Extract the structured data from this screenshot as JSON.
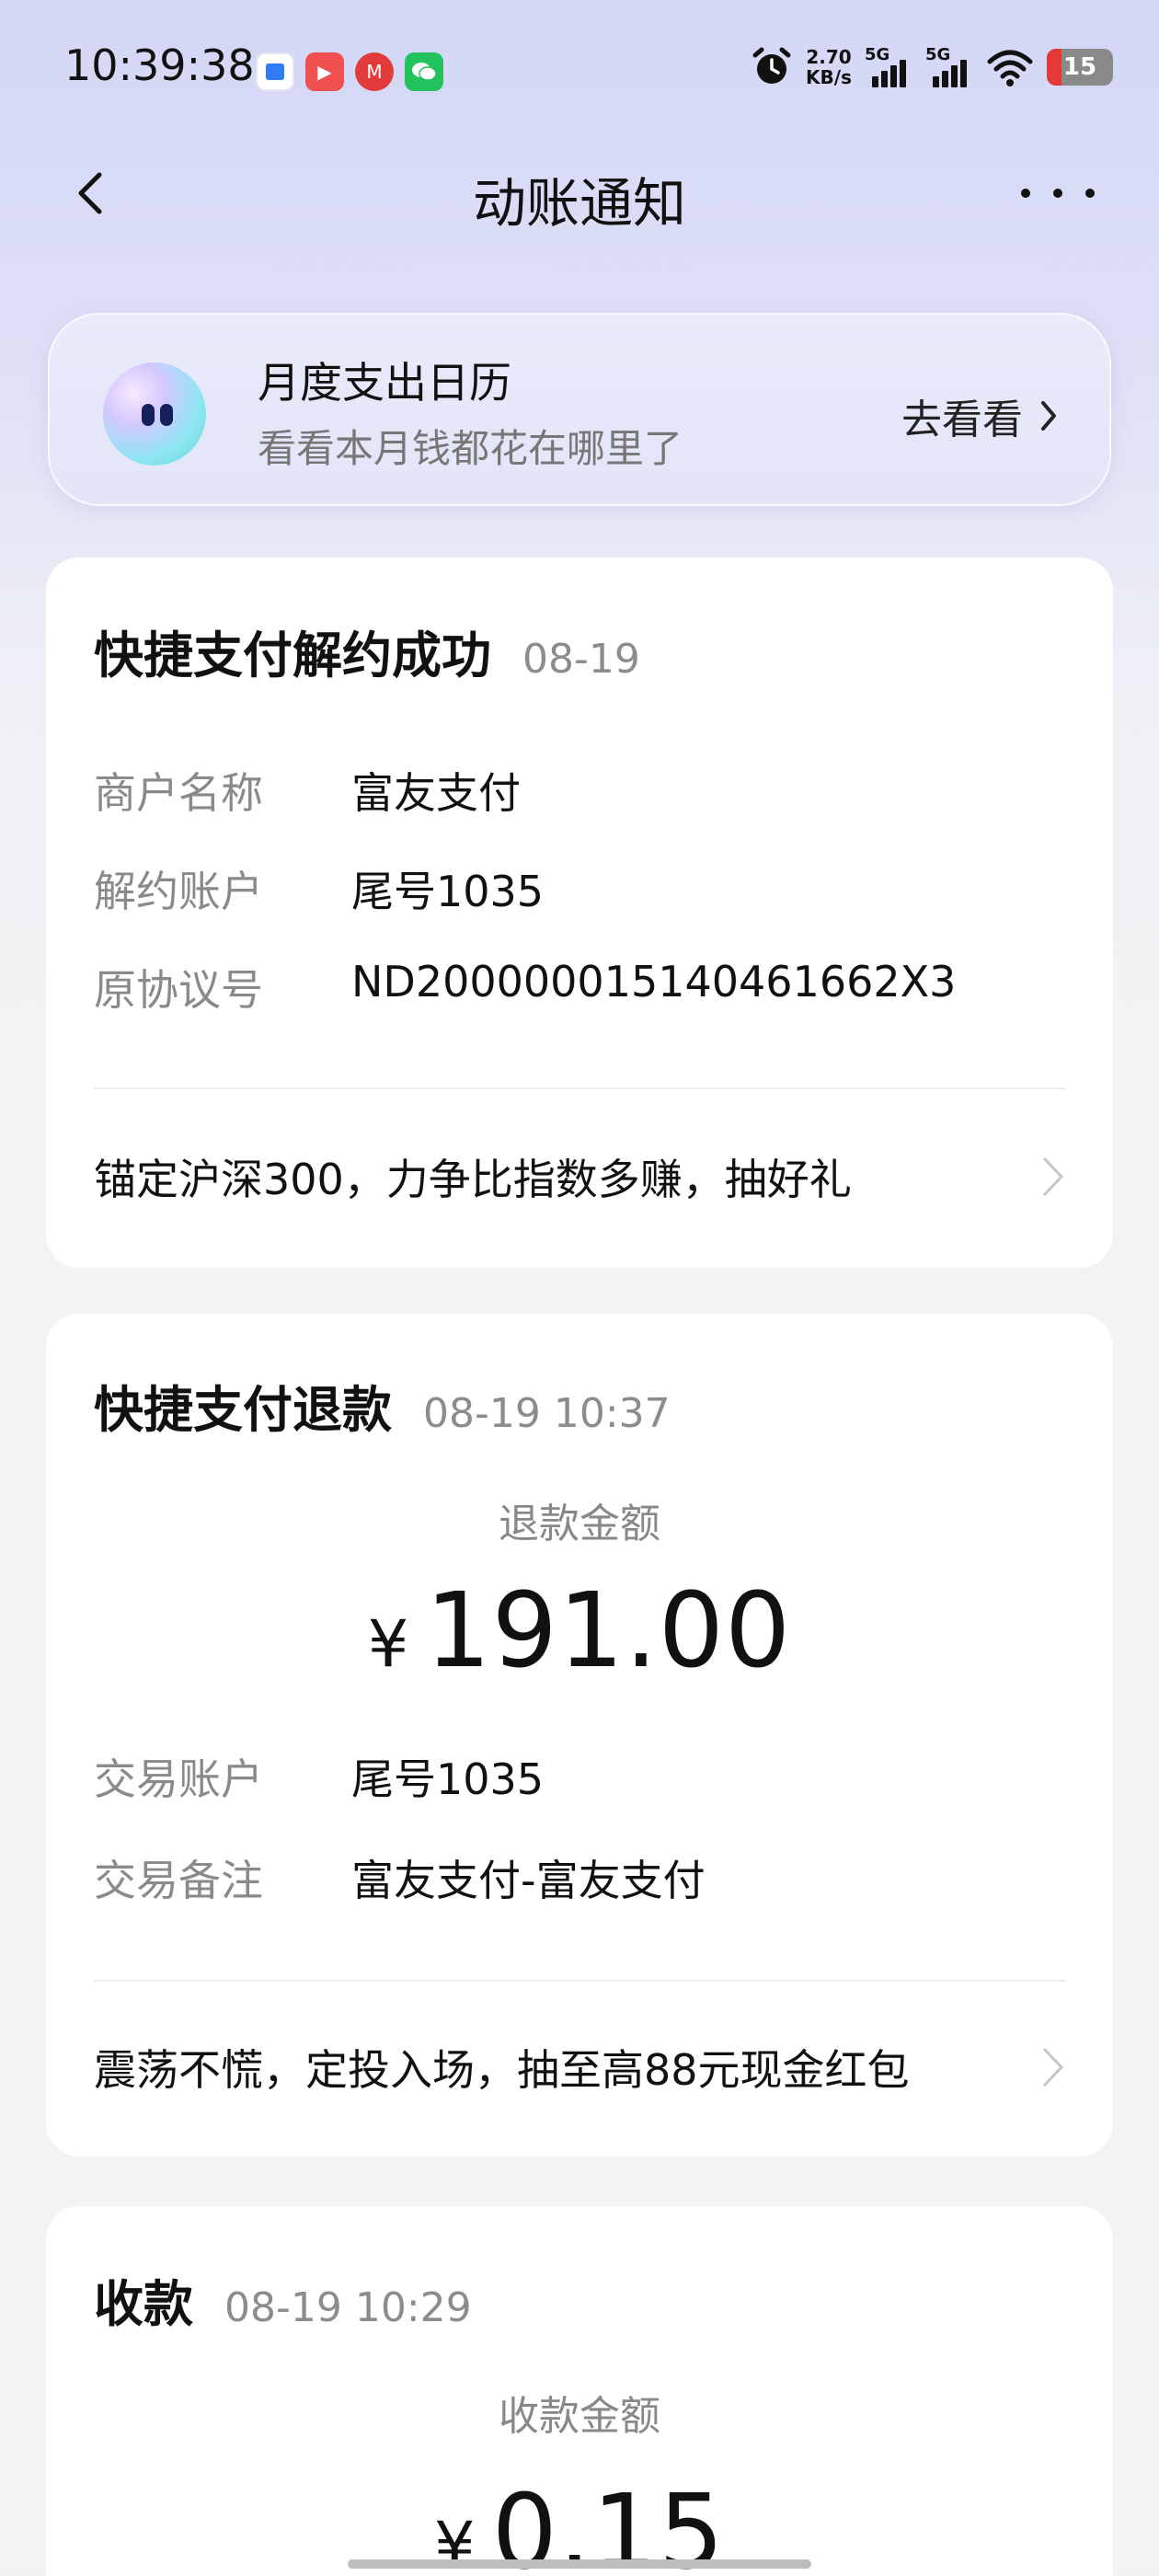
{
  "status_bar": {
    "time": "10:39:38",
    "net_speed_value": "2.70",
    "net_speed_unit": "KB/s",
    "signal1_label": "5G",
    "signal2_label": "5G",
    "battery": "15",
    "icons": [
      "app-icon-1",
      "app-icon-2",
      "china-merchants-icon",
      "wechat-icon",
      "alarm-icon",
      "wifi-icon"
    ]
  },
  "nav": {
    "title": "动账通知"
  },
  "banner": {
    "title": "月度支出日历",
    "subtitle": "看看本月钱都花在哪里了",
    "link": "去看看"
  },
  "cards": [
    {
      "title": "快捷支付解约成功",
      "date": "08-19",
      "rows": [
        {
          "label": "商户名称",
          "value": "富友支付"
        },
        {
          "label": "解约账户",
          "value": "尾号1035"
        },
        {
          "label": "原协议号",
          "value": "ND200000015140461662X3"
        }
      ],
      "promo": "锚定沪深300，力争比指数多赚，抽好礼"
    },
    {
      "title": "快捷支付退款",
      "date": "08-19 10:37",
      "amount_label": "退款金额",
      "currency": "¥",
      "amount": "191.00",
      "rows": [
        {
          "label": "交易账户",
          "value": "尾号1035"
        },
        {
          "label": "交易备注",
          "value": "富友支付-富友支付"
        }
      ],
      "promo": "震荡不慌，定投入场，抽至高88元现金红包"
    },
    {
      "title": "收款",
      "date": "08-19 10:29",
      "amount_label": "收款金额",
      "currency": "¥",
      "amount": "0.15"
    }
  ]
}
